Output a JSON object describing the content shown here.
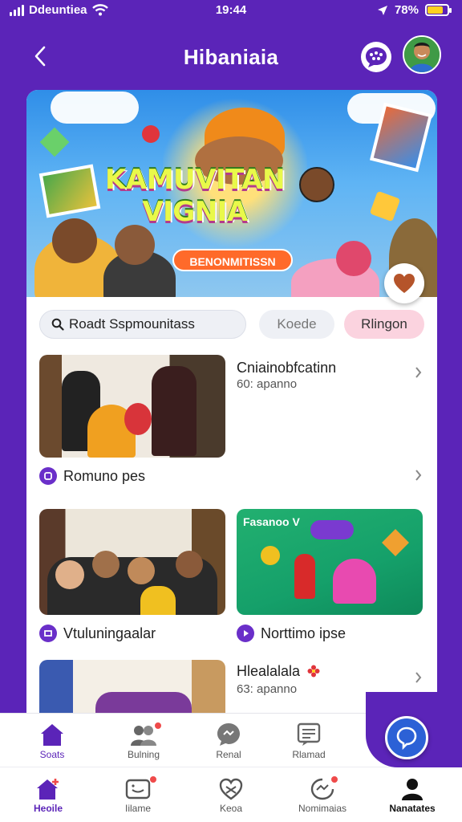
{
  "status_bar": {
    "carrier": "Ddeuntiea",
    "time": "19:44",
    "battery": "78%",
    "battery_level": 0.78
  },
  "header": {
    "title": "Hibaniaia"
  },
  "banner": {
    "title_line1": "KAMUVITAN",
    "title_line2": "VIGNIA",
    "pill": "BENONMITISSN"
  },
  "search": {
    "value": "Roadt Sspmounitass"
  },
  "chips": [
    "Koede",
    "Rlingon"
  ],
  "list": {
    "item1": {
      "title": "Cniainobfcatinn",
      "subtitle": "60: apanno",
      "tag": "Romuno pes"
    },
    "item2": {
      "tag": "Vtuluningaalar"
    },
    "item3": {
      "banner_text": "Fasanoo V",
      "tag": "Norttimo ipse"
    },
    "item4": {
      "title": "Hlealalala",
      "subtitle": "63: apanno"
    }
  },
  "sub_nav": [
    {
      "label": "Soats",
      "icon": "home-icon"
    },
    {
      "label": "Bulning",
      "icon": "group-icon"
    },
    {
      "label": "Renal",
      "icon": "chat-icon"
    },
    {
      "label": "Rlamad",
      "icon": "document-icon"
    }
  ],
  "tab_bar": [
    {
      "label": "Heoile",
      "icon": "home-icon"
    },
    {
      "label": "Iilame",
      "icon": "message-icon"
    },
    {
      "label": "Keoa",
      "icon": "heart-icon"
    },
    {
      "label": "Nomimaias",
      "icon": "notification-icon"
    },
    {
      "label": "Nanatates",
      "icon": "profile-icon"
    }
  ],
  "colors": {
    "accent": "#5b24b8",
    "fab": "#2c61d6",
    "chip_pink": "#fbd3df",
    "badge": "#ef4a4a"
  }
}
